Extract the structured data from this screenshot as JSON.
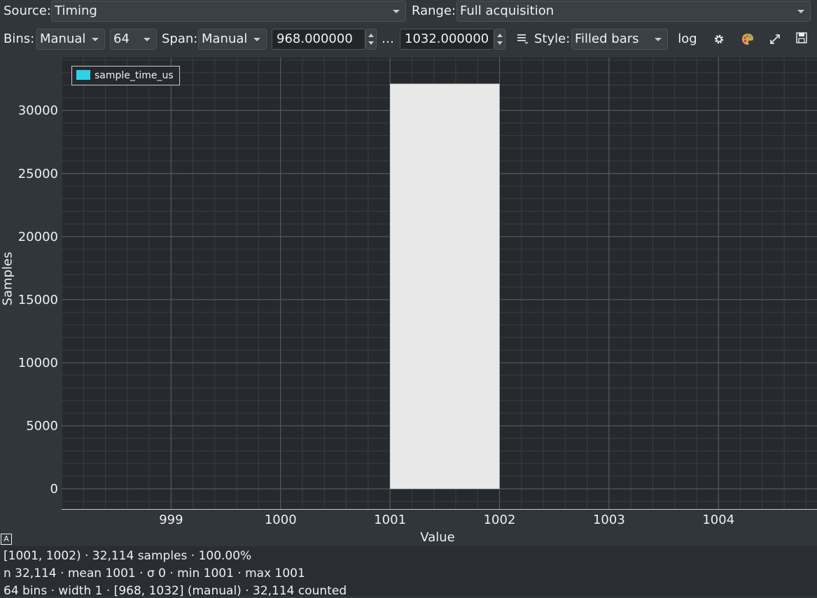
{
  "toolbar": {
    "source_label": "Source:",
    "source_value": "Timing",
    "range_label": "Range:",
    "range_value": "Full acquisition",
    "bins_label": "Bins:",
    "bins_mode": "Manual",
    "bins_count": "64",
    "span_label": "Span:",
    "span_mode": "Manual",
    "span_min": "968.000000",
    "span_sep": "…",
    "span_max": "1032.000000",
    "style_label": "Style:",
    "style_value": "Filled bars",
    "log_label": "log",
    "icons": [
      "lines-menu-icon",
      "gear-icon",
      "palette-icon",
      "expand-icon",
      "save-icon"
    ]
  },
  "chart_data": {
    "type": "bar",
    "xlabel": "Value",
    "ylabel": "Samples",
    "xlim": [
      998.0,
      1004.9
    ],
    "ylim": [
      -1600,
      34200
    ],
    "xticks": [
      999,
      1000,
      1001,
      1002,
      1003,
      1004
    ],
    "yticks": [
      0,
      5000,
      10000,
      15000,
      20000,
      25000,
      30000
    ],
    "grid": true,
    "legend_position": "top-left",
    "series": [
      {
        "name": "sample_time_us",
        "color": "#2ed1e6",
        "bars": [
          {
            "x0": 1001,
            "x1": 1002,
            "value": 32114
          }
        ]
      }
    ],
    "bar_fill": "#e8e8e8"
  },
  "status": {
    "indicator": "A",
    "line1": "[1001, 1002)  ·  32,114 samples  ·  100.00%",
    "line2": "n 32,114  ·  mean 1001  ·  σ 0  ·  min 1001  ·  max 1001",
    "line3": "64 bins  ·  width 1  ·  [968, 1032] (manual)  ·  32,114 counted"
  }
}
